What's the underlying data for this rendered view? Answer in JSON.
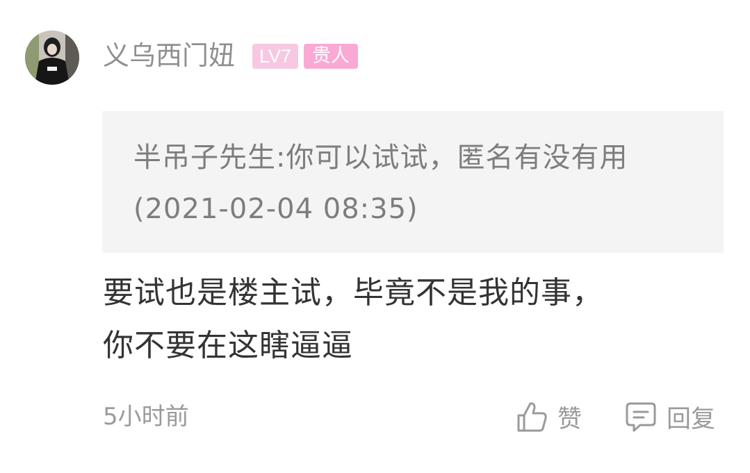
{
  "comment": {
    "author": {
      "name": "义乌西门妞",
      "level_badge": "LV7",
      "title_badge": "贵人",
      "avatar_icon": "user-avatar"
    },
    "quoted_reply": "半吊子先生:你可以试试，匿名有没有用 (2021-02-04 08:35)",
    "text_line1": "要试也是楼主试，毕竟不是我的事，",
    "text_line2": "你不要在这瞎逼逼",
    "time": "5小时前",
    "actions": {
      "like_label": "赞",
      "like_icon": "thumbs-up-icon",
      "reply_label": "回复",
      "reply_icon": "comment-bubble-icon"
    }
  },
  "colors": {
    "username": "#8f8f8f",
    "level_badge_bg": "#f7c8e2",
    "title_badge_bg": "#f9a9d3",
    "quote_bg": "#f4f4f4",
    "body_text": "#333333",
    "muted_text": "#9a9a9a"
  }
}
